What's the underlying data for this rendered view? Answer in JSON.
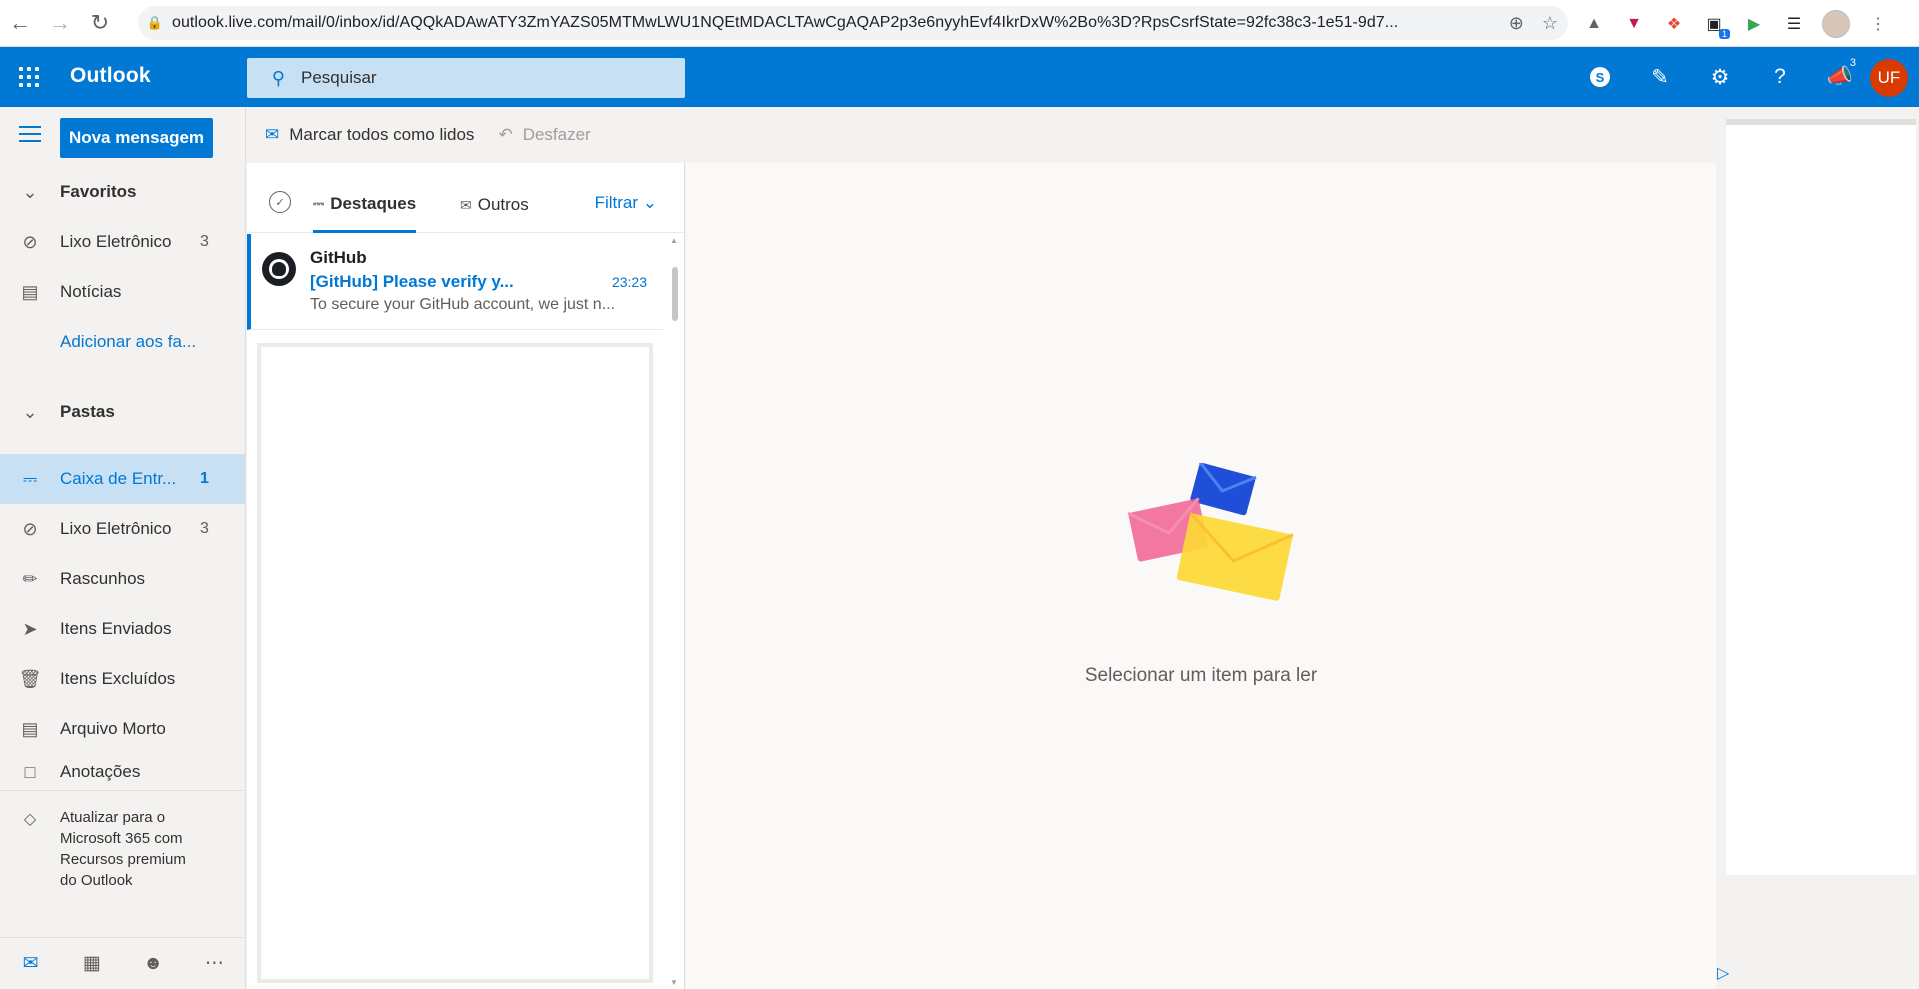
{
  "browser": {
    "url": "outlook.live.com/mail/0/inbox/id/AQQkADAwATY3ZmYAZS05MTMwLWU1NQEtMDACLTAwCgAQAP2p3e6nyyhEvf4IkrDxW%2Bo%3D?RpsCsrfState=92fc38c3-1e51-9d7...",
    "ext_badge": "1"
  },
  "header": {
    "brand": "Outlook",
    "search_placeholder": "Pesquisar",
    "skype_letter": "S",
    "notification_count": "3",
    "avatar_initials": "UF",
    "accent_color": "#0078d4"
  },
  "nav": {
    "new_message": "Nova mensagem",
    "favorites_title": "Favoritos",
    "favorites": [
      {
        "label": "Lixo Eletrônico",
        "count": "3",
        "icon": "block-icon"
      },
      {
        "label": "Notícias",
        "count": "",
        "icon": "news-icon"
      },
      {
        "label": "Adicionar aos fa...",
        "count": "",
        "icon": ""
      }
    ],
    "folders_title": "Pastas",
    "folders": [
      {
        "label": "Caixa de Entr...",
        "count": "1",
        "icon": "inbox-icon"
      },
      {
        "label": "Lixo Eletrônico",
        "count": "3",
        "icon": "block-icon"
      },
      {
        "label": "Rascunhos",
        "count": "",
        "icon": "pencil-icon"
      },
      {
        "label": "Itens Enviados",
        "count": "",
        "icon": "send-icon"
      },
      {
        "label": "Itens Excluídos",
        "count": "",
        "icon": "trash-icon"
      },
      {
        "label": "Arquivo Morto",
        "count": "",
        "icon": "archive-icon"
      },
      {
        "label": "Anotações",
        "count": "",
        "icon": "note-icon"
      }
    ],
    "upsell": "Atualizar para o Microsoft 365 com Recursos premium do Outlook"
  },
  "commands": {
    "mark_all_read": "Marcar todos como lidos",
    "undo": "Desfazer"
  },
  "list": {
    "tab_focused": "Destaques",
    "tab_other": "Outros",
    "filter": "Filtrar",
    "messages": [
      {
        "sender": "GitHub",
        "subject": "[GitHub] Please verify y...",
        "time": "23:23",
        "preview": "To secure your GitHub account, we just n..."
      }
    ]
  },
  "reading": {
    "empty_text": "Selecionar um item para ler"
  }
}
